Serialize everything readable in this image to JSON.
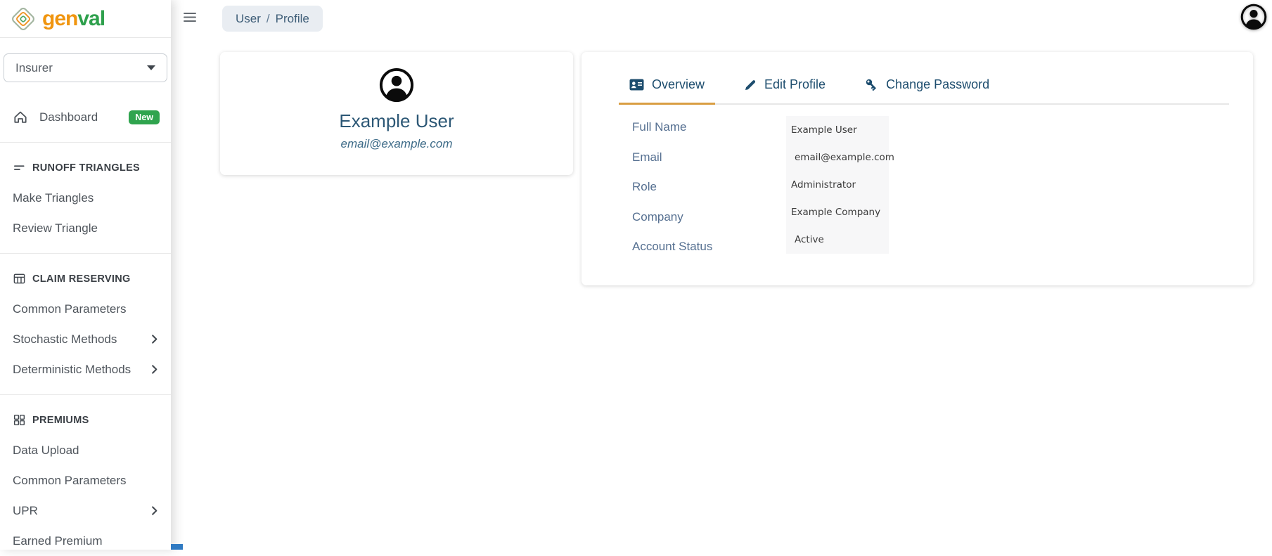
{
  "brand": {
    "name_part1": "gen",
    "name_part2": "val"
  },
  "sidebar": {
    "insurer_select": {
      "value": "Insurer"
    },
    "dashboard": {
      "label": "Dashboard",
      "badge": "New"
    },
    "sections": [
      {
        "title": "RUNOFF TRIANGLES",
        "items": [
          {
            "label": "Make Triangles"
          },
          {
            "label": "Review Triangle"
          }
        ]
      },
      {
        "title": "CLAIM RESERVING",
        "items": [
          {
            "label": "Common Parameters"
          },
          {
            "label": "Stochastic Methods"
          },
          {
            "label": "Deterministic Methods"
          }
        ]
      },
      {
        "title": "PREMIUMS",
        "items": [
          {
            "label": "Data Upload"
          },
          {
            "label": "Common Parameters"
          },
          {
            "label": "UPR"
          },
          {
            "label": "Earned Premium"
          }
        ]
      }
    ]
  },
  "header": {
    "breadcrumb": {
      "section": "User",
      "separator": "/",
      "page": "Profile"
    }
  },
  "profile_card": {
    "name": "Example User",
    "email": "email@example.com"
  },
  "details_card": {
    "tabs": [
      {
        "label": "Overview"
      },
      {
        "label": "Edit Profile"
      },
      {
        "label": "Change Password"
      }
    ],
    "fields": [
      {
        "label": "Full Name",
        "value": "Example User"
      },
      {
        "label": "Email",
        "value": "email@example.com"
      },
      {
        "label": "Role",
        "value": "Administrator"
      },
      {
        "label": "Company",
        "value": "Example Company"
      },
      {
        "label": "Account Status",
        "value": "Active"
      }
    ]
  },
  "colors": {
    "brand_orange": "#f0950f",
    "brand_green": "#2ea04c",
    "badge_green": "#2fa44e",
    "tab_text": "#1d4d6e",
    "active_tab_underline": "#d99e43",
    "field_label_blue": "#567091"
  }
}
